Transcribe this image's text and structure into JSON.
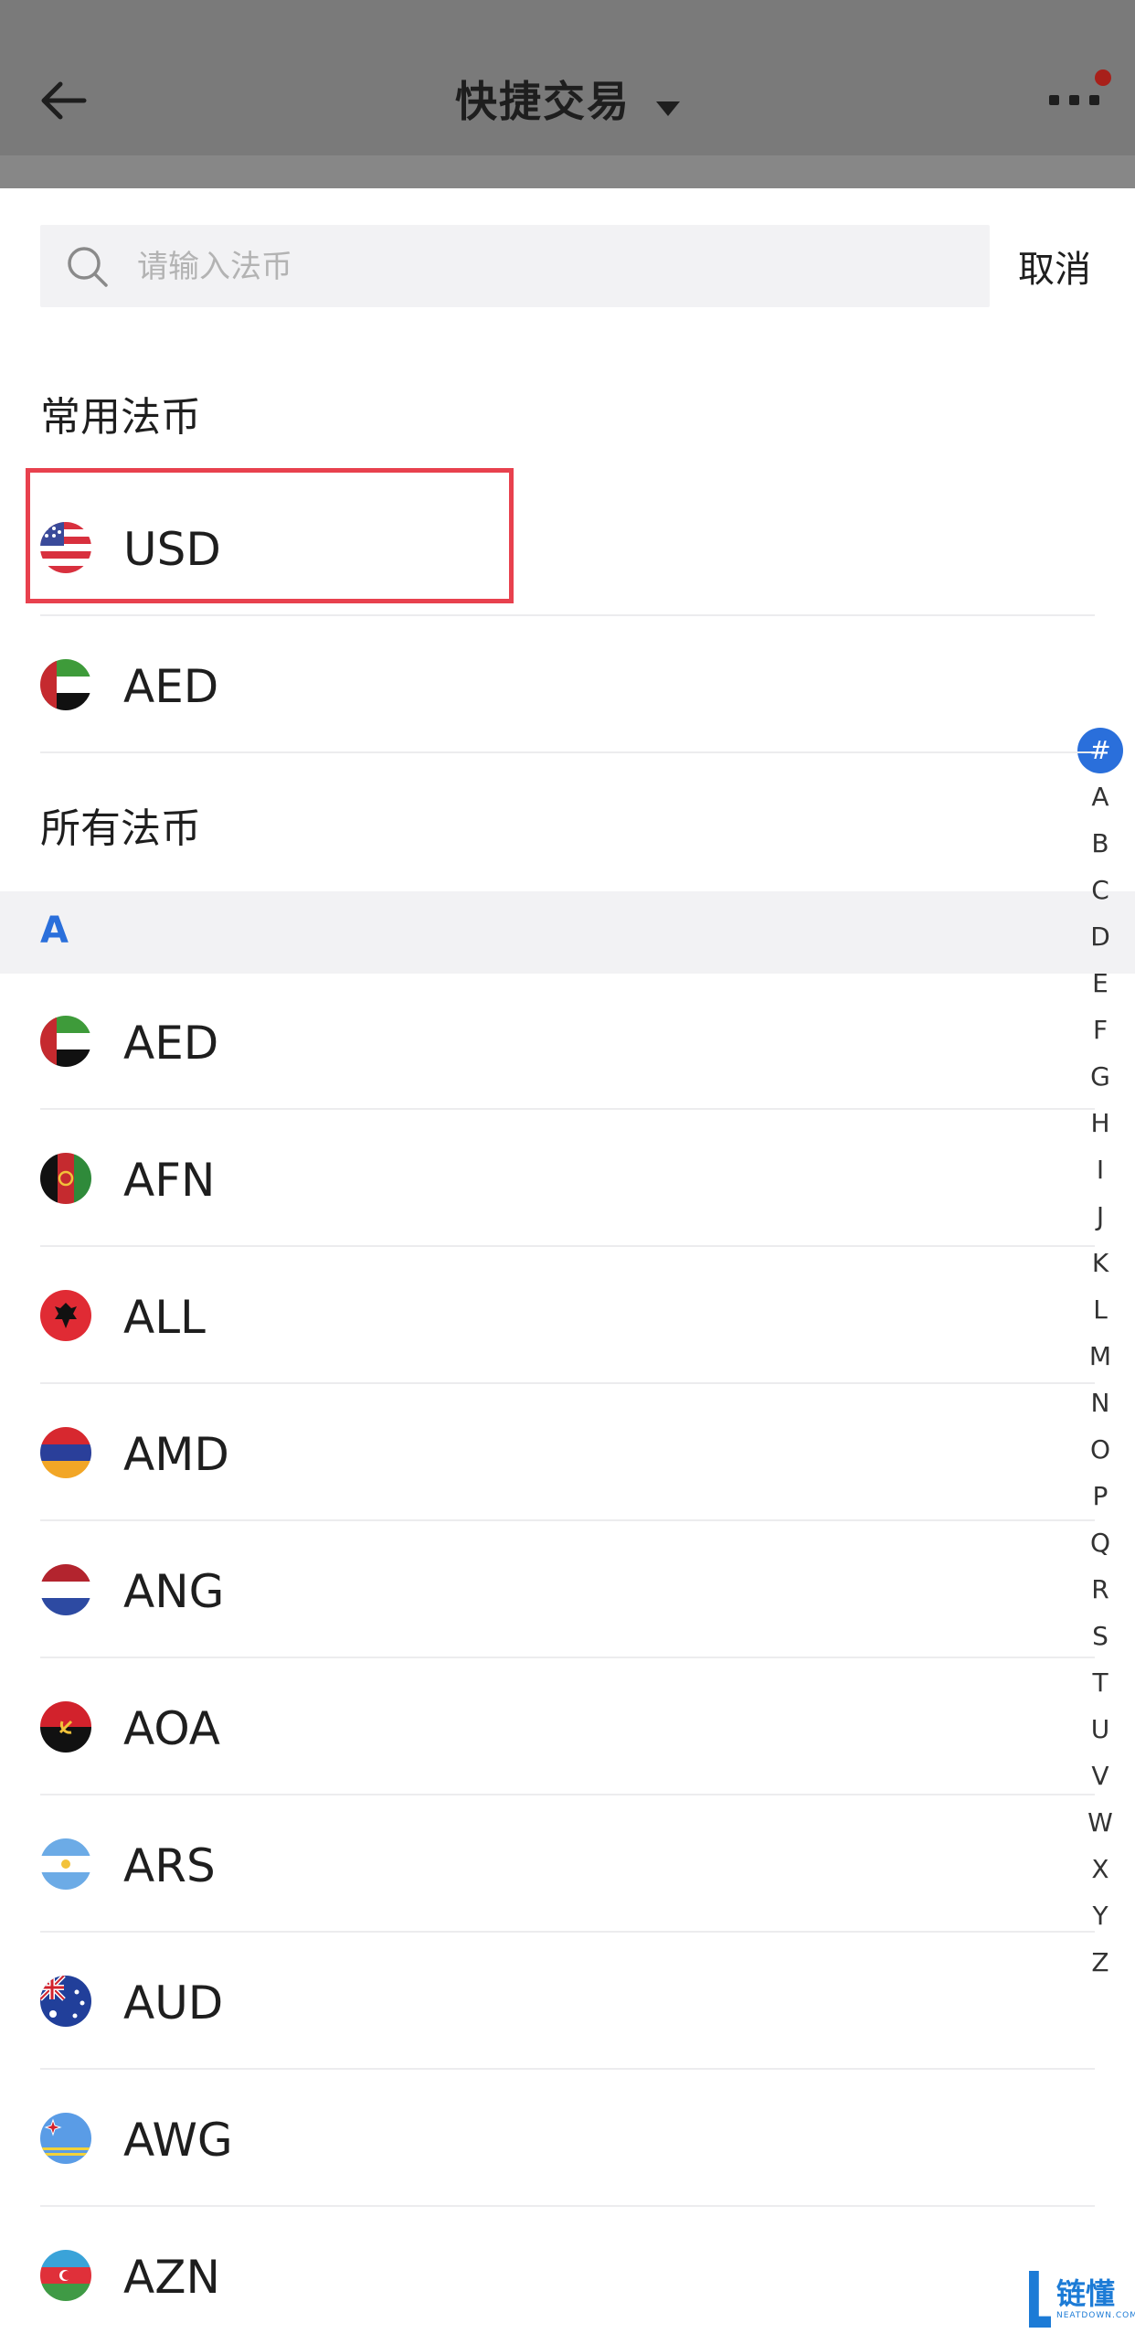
{
  "header": {
    "title": "快捷交易"
  },
  "search": {
    "placeholder": "请输入法币",
    "cancel_label": "取消"
  },
  "sections": {
    "common_title": "常用法币",
    "all_title": "所有法币"
  },
  "common": [
    {
      "code": "USD"
    },
    {
      "code": "AED"
    }
  ],
  "group_letter": "A",
  "all": [
    {
      "code": "AED"
    },
    {
      "code": "AFN"
    },
    {
      "code": "ALL"
    },
    {
      "code": "AMD"
    },
    {
      "code": "ANG"
    },
    {
      "code": "AOA"
    },
    {
      "code": "ARS"
    },
    {
      "code": "AUD"
    },
    {
      "code": "AWG"
    },
    {
      "code": "AZN"
    }
  ],
  "index": [
    "#",
    "A",
    "B",
    "C",
    "D",
    "E",
    "F",
    "G",
    "H",
    "I",
    "J",
    "K",
    "L",
    "M",
    "N",
    "O",
    "P",
    "Q",
    "R",
    "S",
    "T",
    "U",
    "V",
    "W",
    "X",
    "Y",
    "Z"
  ],
  "watermark": {
    "text": "链懂",
    "sub": "NEATDOWN.COM"
  },
  "colors": {
    "accent": "#2a6fdb",
    "highlight": "#e8414e",
    "overlay": "#7a7a7a"
  }
}
